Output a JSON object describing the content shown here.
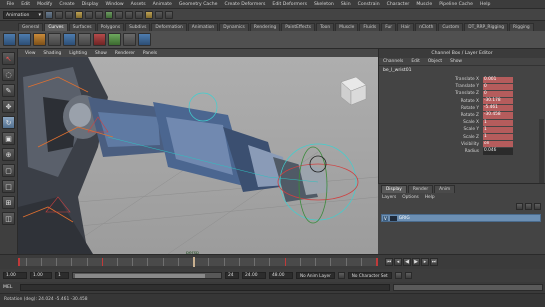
{
  "menubar": {
    "items": [
      "File",
      "Edit",
      "Modify",
      "Create",
      "Display",
      "Window",
      "Assets",
      "Animate",
      "Geometry Cache",
      "Create Deformers",
      "Edit Deformers",
      "Skeleton",
      "Skin",
      "Constrain",
      "Character",
      "Muscle",
      "Pipeline Cache",
      "Help"
    ]
  },
  "statusline": {
    "mode": "Animation"
  },
  "shelf": {
    "tabs": [
      "General",
      "Curves",
      "Surfaces",
      "Polygons",
      "Subdivs",
      "Deformation",
      "Animation",
      "Dynamics",
      "Rendering",
      "PaintEffects",
      "Toon",
      "Muscle",
      "Fluids",
      "Fur",
      "Hair",
      "nCloth",
      "Custom",
      "DT_RRP_Rigging",
      "Rigging"
    ],
    "active_tab": "Curves"
  },
  "viewport": {
    "menu": [
      "View",
      "Shading",
      "Lighting",
      "Show",
      "Renderer",
      "Panels"
    ],
    "camera_label": "persp"
  },
  "channelbox": {
    "title": "Channel Box / Layer Editor",
    "menu": [
      "Channels",
      "Edit",
      "Object",
      "Show"
    ],
    "node": "be_l_wrist01",
    "attributes": [
      {
        "label": "Translate X",
        "value": "0.001",
        "keyed": true
      },
      {
        "label": "Translate Y",
        "value": "0",
        "keyed": true
      },
      {
        "label": "Translate Z",
        "value": "0",
        "keyed": true
      },
      {
        "label": "Rotate X",
        "value": "-30.178",
        "keyed": true
      },
      {
        "label": "Rotate Y",
        "value": "-5.461",
        "keyed": true
      },
      {
        "label": "Rotate Z",
        "value": "-30.458",
        "keyed": true
      },
      {
        "label": "Scale X",
        "value": "1",
        "keyed": true
      },
      {
        "label": "Scale Y",
        "value": "1",
        "keyed": true
      },
      {
        "label": "Scale Z",
        "value": "1",
        "keyed": true
      },
      {
        "label": "Visibility",
        "value": "on",
        "keyed": true
      },
      {
        "label": "Radius",
        "value": "0.046",
        "keyed": false
      }
    ]
  },
  "layerpanel": {
    "tabs": [
      "Display",
      "Render",
      "Anim"
    ],
    "active_tab": "Display",
    "menu": [
      "Layers",
      "Options",
      "Help"
    ],
    "layer": {
      "visible": "V",
      "name": "GRIG"
    }
  },
  "timeslider": {
    "current_frame": 24,
    "start": 1,
    "end": 48,
    "keys": [
      1,
      12,
      24,
      36,
      48
    ]
  },
  "rangeslider": {
    "start_field": "1.00",
    "anim_start_field": "1.00",
    "range_start": "1",
    "range_end": "24",
    "end_field": "24.00",
    "anim_end_field": "48.00",
    "anim_layer": "No Anim Layer",
    "char_set": "No Character Set"
  },
  "cmdline": {
    "label": "MEL"
  },
  "helpline": {
    "text": "Rotation (deg):   24.024   -5.461   -30.458"
  }
}
